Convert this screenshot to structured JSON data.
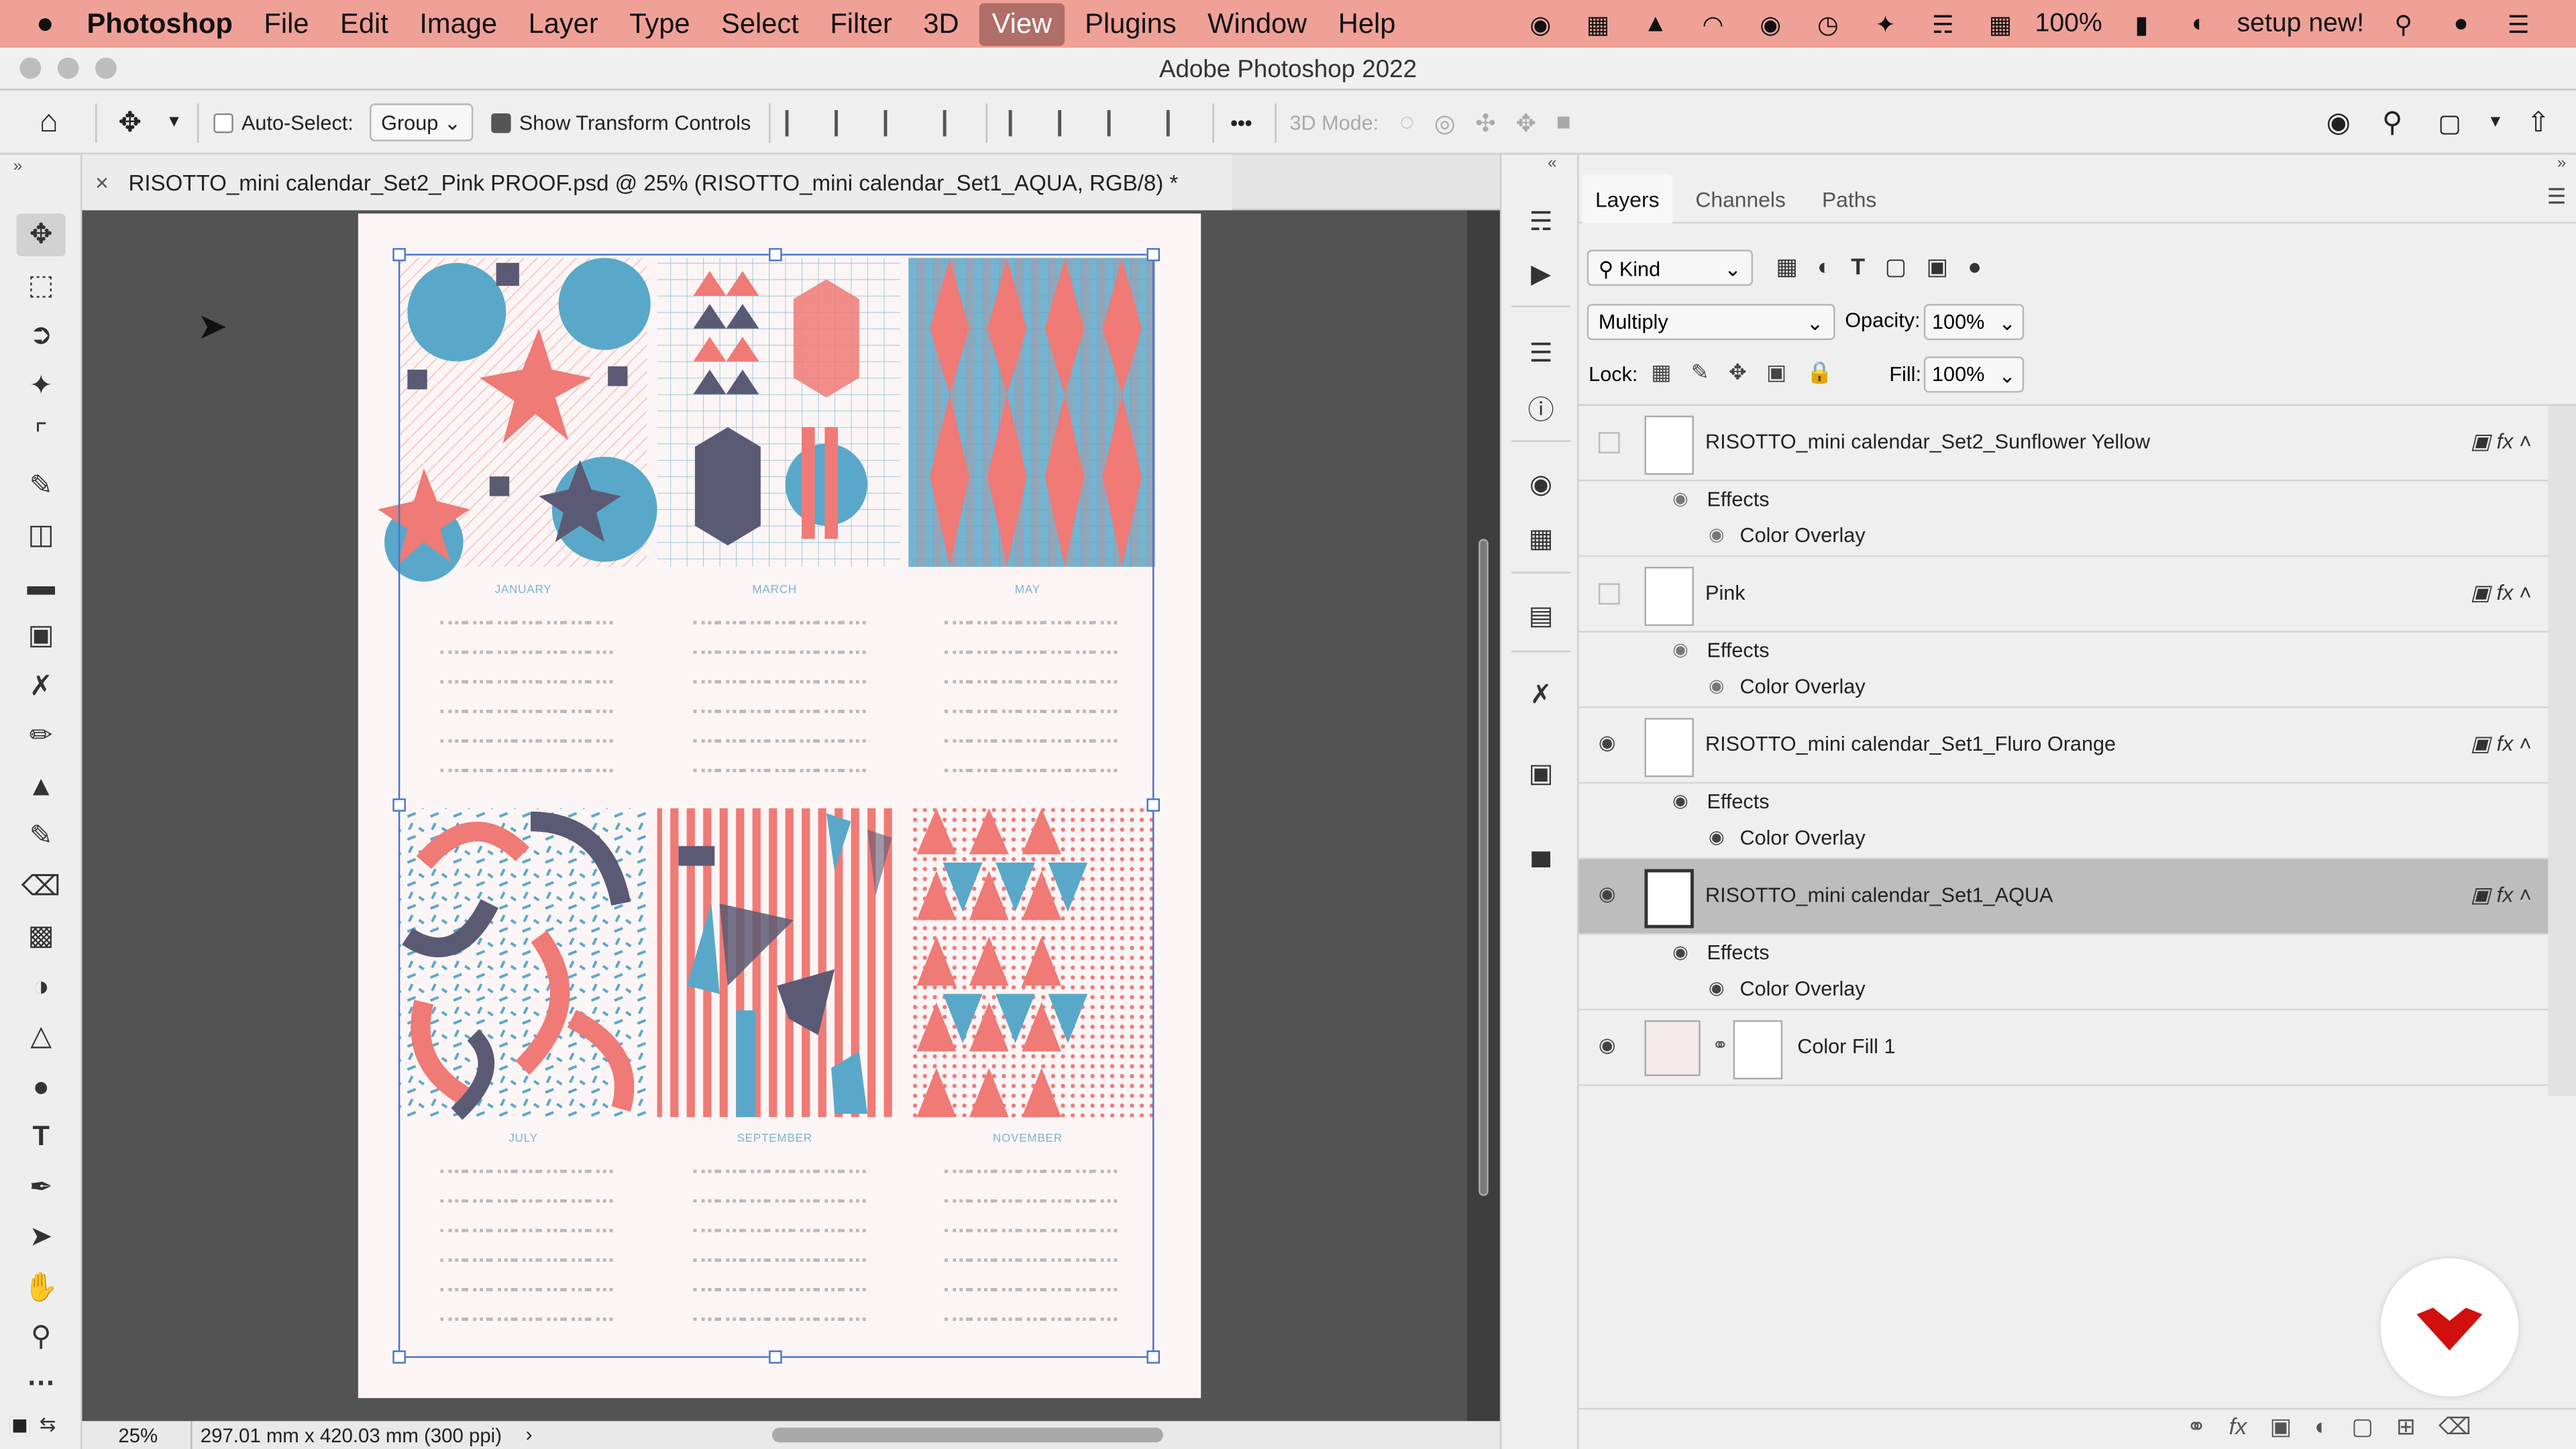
{
  "menubar": {
    "apple": "",
    "items": [
      "Photoshop",
      "File",
      "Edit",
      "Image",
      "Layer",
      "Type",
      "Select",
      "Filter",
      "3D",
      "View",
      "Plugins",
      "Window",
      "Help"
    ],
    "selected": "View",
    "battery": "100%",
    "user": "setup new!"
  },
  "window": {
    "title": "Adobe Photoshop 2022"
  },
  "options": {
    "auto_select_label": "Auto-Select:",
    "auto_select_value": "Group",
    "transform_label": "Show Transform Controls",
    "mode3d_label": "3D Mode:",
    "more": "•••"
  },
  "document": {
    "tab_title": "RISOTTO_mini calendar_Set2_Pink PROOF.psd @ 25% (RISOTTO_mini calendar_Set1_AQUA, RGB/8) *",
    "zoom": "25%",
    "size": "297.01 mm x 420.03 mm (300 ppi)",
    "months": [
      "JANUARY",
      "MARCH",
      "MAY",
      "JULY",
      "SEPTEMBER",
      "NOVEMBER"
    ],
    "colors": {
      "pink": "#ef7a76",
      "blue": "#5aa8c9",
      "navy": "#5b5a74",
      "paper": "#fcf5f5"
    }
  },
  "layers_panel": {
    "tabs": [
      "Layers",
      "Channels",
      "Paths"
    ],
    "filter": "Kind",
    "blend_mode": "Multiply",
    "opacity_label": "Opacity:",
    "opacity": "100%",
    "lock_label": "Lock:",
    "fill_label": "Fill:",
    "fill": "100%",
    "effects_label": "Effects",
    "overlay_label": "Color Overlay",
    "layers": [
      {
        "name": "RISOTTO_mini calendar_Set2_Sunflower Yellow",
        "visible": false
      },
      {
        "name": "Pink",
        "visible": false
      },
      {
        "name": "RISOTTO_mini calendar_Set1_Fluro Orange",
        "visible": true
      },
      {
        "name": "RISOTTO_mini calendar_Set1_AQUA",
        "visible": true,
        "selected": true
      },
      {
        "name": "Color Fill 1",
        "visible": true
      }
    ]
  }
}
